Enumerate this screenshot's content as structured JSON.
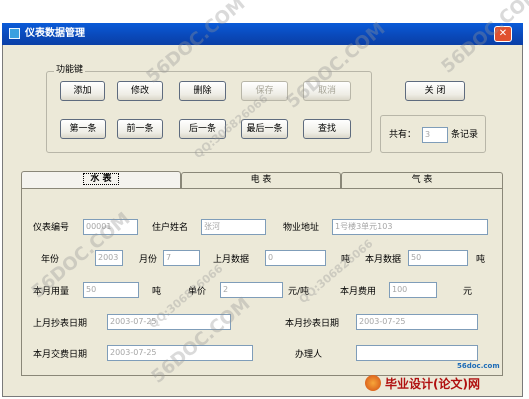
{
  "window": {
    "title": "仪表数据管理",
    "close_glyph": "✕"
  },
  "function_group": {
    "caption": "功能键",
    "buttons": {
      "add": "添加",
      "edit": "修改",
      "delete": "删除",
      "save": "保存",
      "cancel": "取消",
      "first": "第一条",
      "prev": "前一条",
      "next": "后一条",
      "last": "最后一条",
      "find": "查找"
    }
  },
  "close_button": "关  闭",
  "record_count": {
    "prefix": "共有：",
    "value": "3",
    "suffix": "条记录"
  },
  "tabs": [
    {
      "label": "水  表",
      "active": true
    },
    {
      "label": "电  表",
      "active": false
    },
    {
      "label": "气  表",
      "active": false
    }
  ],
  "form": {
    "meter_no": {
      "label": "仪表编号",
      "value": "00001"
    },
    "resident_name": {
      "label": "住户姓名",
      "value": "张河"
    },
    "address": {
      "label": "物业地址",
      "value": "1号楼3单元103"
    },
    "year": {
      "label": "年份",
      "value": "2003"
    },
    "month": {
      "label": "月份",
      "value": "7"
    },
    "last_month_reading": {
      "label": "上月数据",
      "value": "0",
      "unit": "吨"
    },
    "this_month_reading": {
      "label": "本月数据",
      "value": "50",
      "unit": "吨"
    },
    "usage": {
      "label": "本月用量",
      "value": "50",
      "unit": "吨"
    },
    "unit_price": {
      "label": "单价",
      "value": "2",
      "unit": "元/吨"
    },
    "fee": {
      "label": "本月费用",
      "value": "100",
      "unit": "元"
    },
    "last_read_date": {
      "label": "上月抄表日期",
      "value": "2003-07-25"
    },
    "this_read_date": {
      "label": "本月抄表日期",
      "value": "2003-07-25"
    },
    "pay_date": {
      "label": "本月交费日期",
      "value": "2003-07-25"
    },
    "handler": {
      "label": "办理人",
      "value": ""
    }
  },
  "watermarks": [
    "56DOC.COM",
    "56DOC.COM",
    "56DOC.COM",
    "56DOC.COM",
    "56DOC.COM",
    "QQ:306826066",
    "QQ:306826066",
    "QQ:306826066"
  ],
  "brand": {
    "text": "毕业设计(论文)网",
    "site": "56doc.com"
  }
}
